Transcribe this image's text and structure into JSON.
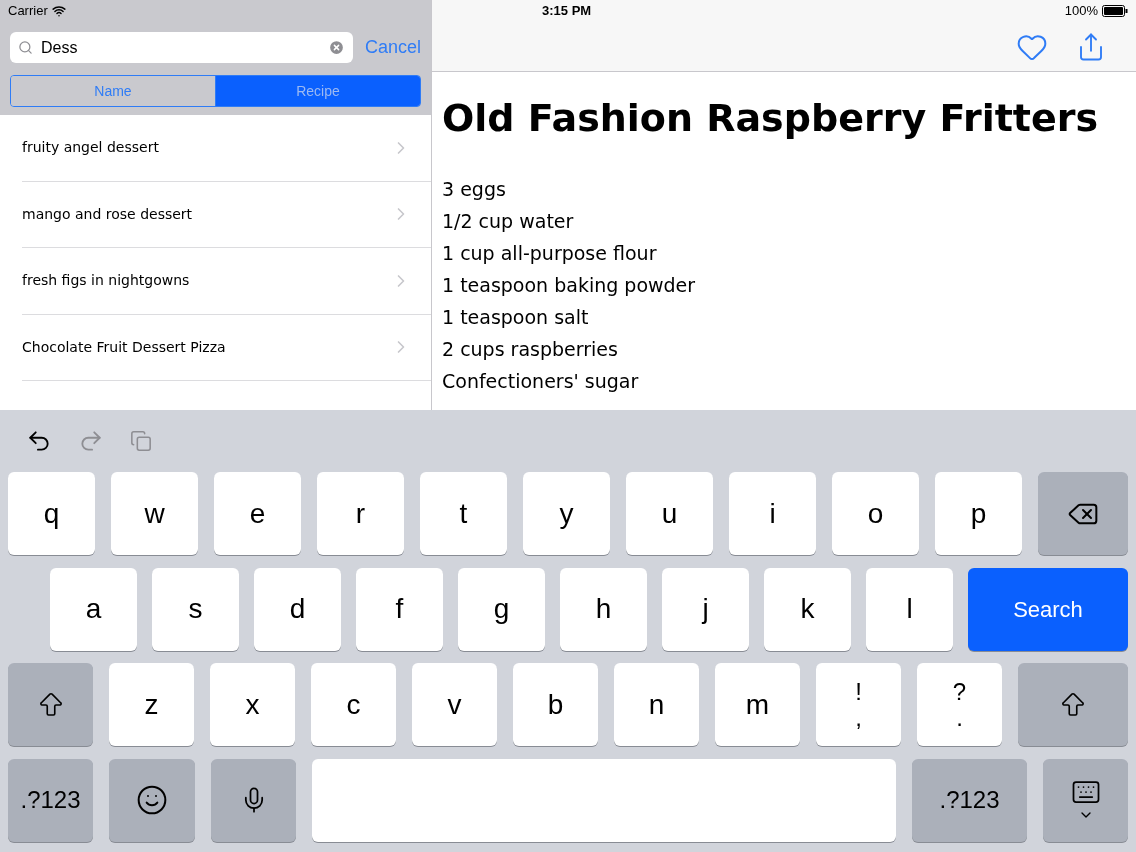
{
  "status_bar": {
    "carrier": "Carrier",
    "time": "3:15 PM",
    "battery": "100%"
  },
  "search": {
    "value": "Dess",
    "cancel": "Cancel"
  },
  "segments": [
    {
      "label": "Name",
      "selected": false
    },
    {
      "label": "Recipe",
      "selected": true
    }
  ],
  "results": [
    "fruity angel dessert",
    "mango and rose dessert",
    "fresh figs in nightgowns",
    "Chocolate Fruit Dessert Pizza"
  ],
  "detail": {
    "title": "Old Fashion Raspberry Fritters",
    "ingredients": [
      "3 eggs",
      "1/2 cup water",
      "1 cup all-purpose flour",
      "1 teaspoon baking powder",
      "1 teaspoon salt",
      "2 cups raspberries",
      "Confectioners' sugar"
    ]
  },
  "keyboard": {
    "rows": [
      [
        {
          "kind": "char",
          "label": "q"
        },
        {
          "kind": "char",
          "label": "w"
        },
        {
          "kind": "char",
          "label": "e"
        },
        {
          "kind": "char",
          "label": "r"
        },
        {
          "kind": "char",
          "label": "t"
        },
        {
          "kind": "char",
          "label": "y"
        },
        {
          "kind": "char",
          "label": "u"
        },
        {
          "kind": "char",
          "label": "i"
        },
        {
          "kind": "char",
          "label": "o"
        },
        {
          "kind": "char",
          "label": "p"
        },
        {
          "kind": "backspace"
        }
      ],
      [
        {
          "kind": "char",
          "label": "a"
        },
        {
          "kind": "char",
          "label": "s"
        },
        {
          "kind": "char",
          "label": "d"
        },
        {
          "kind": "char",
          "label": "f"
        },
        {
          "kind": "char",
          "label": "g"
        },
        {
          "kind": "char",
          "label": "h"
        },
        {
          "kind": "char",
          "label": "j"
        },
        {
          "kind": "char",
          "label": "k"
        },
        {
          "kind": "char",
          "label": "l"
        },
        {
          "kind": "action",
          "label": "Search"
        }
      ],
      [
        {
          "kind": "shift"
        },
        {
          "kind": "char",
          "label": "z"
        },
        {
          "kind": "char",
          "label": "x"
        },
        {
          "kind": "char",
          "label": "c"
        },
        {
          "kind": "char",
          "label": "v"
        },
        {
          "kind": "char",
          "label": "b"
        },
        {
          "kind": "char",
          "label": "n"
        },
        {
          "kind": "char",
          "label": "m"
        },
        {
          "kind": "dual",
          "top": "!",
          "bottom": ","
        },
        {
          "kind": "dual",
          "top": "?",
          "bottom": "."
        },
        {
          "kind": "shift"
        }
      ]
    ],
    "bottom_bar": [
      {
        "kind": "mode",
        "label": ".?123"
      },
      {
        "kind": "emoji"
      },
      {
        "kind": "mic"
      },
      {
        "kind": "space"
      },
      {
        "kind": "mode",
        "label": ".?123"
      },
      {
        "kind": "dismiss"
      }
    ]
  }
}
